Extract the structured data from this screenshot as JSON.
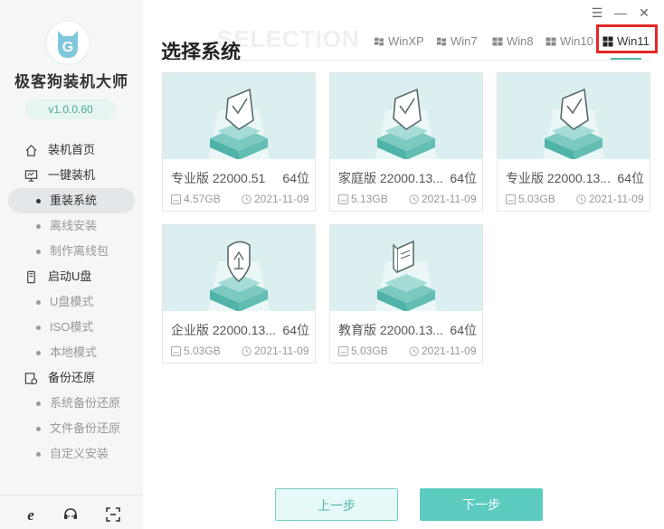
{
  "app": {
    "title": "极客狗装机大师",
    "version": "v1.0.0.60"
  },
  "sidebar": {
    "groups": [
      {
        "label": "装机首页",
        "icon": "home-icon"
      },
      {
        "label": "一键装机",
        "icon": "monitor-icon"
      },
      {
        "label": "启动U盘",
        "icon": "usb-icon"
      },
      {
        "label": "备份还原",
        "icon": "backup-icon"
      }
    ],
    "sub_install": [
      "重装系统",
      "离线安装",
      "制作离线包"
    ],
    "sub_usb": [
      "U盘模式",
      "ISO模式",
      "本地模式"
    ],
    "sub_backup": [
      "系统备份还原",
      "文件备份还原",
      "自定义安装"
    ],
    "active_item": "重装系统",
    "bottom_icons": [
      "ie-icon",
      "support-icon",
      "scan-icon"
    ]
  },
  "header": {
    "title": "选择系统",
    "watermark": "SELECTION"
  },
  "window_controls": {
    "menu": "☰",
    "minimize": "—",
    "close": "✕"
  },
  "tabs": [
    "WinXP",
    "Win7",
    "Win8",
    "Win10",
    "Win11"
  ],
  "active_tab": "Win11",
  "cards": [
    {
      "name": "专业版 22000.51",
      "bits": "64位",
      "size": "4.57GB",
      "date": "2021-11-09",
      "icon": "shield-check-icon"
    },
    {
      "name": "家庭版 22000.13...",
      "bits": "64位",
      "size": "5.13GB",
      "date": "2021-11-09",
      "icon": "shield-check-icon"
    },
    {
      "name": "专业版 22000.13...",
      "bits": "64位",
      "size": "5.03GB",
      "date": "2021-11-09",
      "icon": "shield-check-icon"
    },
    {
      "name": "企业版 22000.13...",
      "bits": "64位",
      "size": "5.03GB",
      "date": "2021-11-09",
      "icon": "shield-enterprise-icon"
    },
    {
      "name": "教育版 22000.13...",
      "bits": "64位",
      "size": "5.03GB",
      "date": "2021-11-09",
      "icon": "book-icon"
    }
  ],
  "buttons": {
    "prev": "上一步",
    "next": "下一步"
  },
  "colors": {
    "accent": "#5ccbc0",
    "highlight": "#e32828",
    "card_bg": "#dbeff0"
  }
}
